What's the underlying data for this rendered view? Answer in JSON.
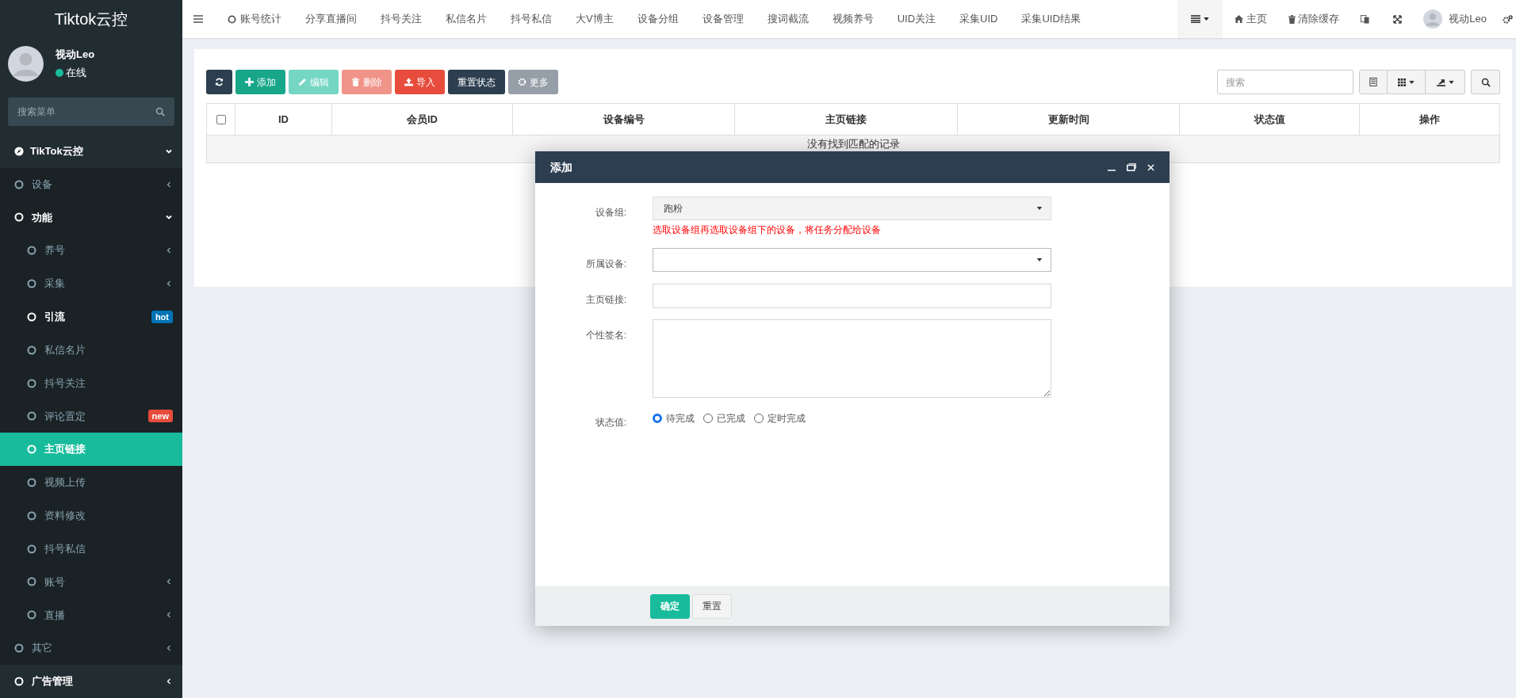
{
  "app_title": "Tiktok云控",
  "user": {
    "name": "视动Leo",
    "status": "在线",
    "online": true
  },
  "sidebar": {
    "search_placeholder": "搜索菜单",
    "items": [
      {
        "label": "TikTok云控",
        "expanded": true,
        "children": [
          {
            "label": "设备",
            "expanded": false,
            "selected": false
          },
          {
            "label": "功能",
            "expanded": true,
            "children": [
              {
                "label": "养号",
                "expanded": false,
                "selected": false
              },
              {
                "label": "采集",
                "expanded": false,
                "selected": false
              },
              {
                "label": "引流",
                "highlighted": true,
                "selected": false,
                "badge": {
                  "text": "hot",
                  "color": "#0073b7"
                }
              },
              {
                "label": "私信名片",
                "selected": false
              },
              {
                "label": "抖号关注",
                "selected": false
              },
              {
                "label": "评论置定",
                "selected": false,
                "badge": {
                  "text": "new",
                  "color": "#e74c3c"
                }
              },
              {
                "label": "主页链接",
                "selected": true
              },
              {
                "label": "视频上传",
                "selected": false
              },
              {
                "label": "资料修改",
                "selected": false
              },
              {
                "label": "抖号私信",
                "selected": false
              },
              {
                "label": "账号",
                "expanded": false,
                "selected": false
              },
              {
                "label": "直播",
                "expanded": false,
                "selected": false
              }
            ]
          },
          {
            "label": "其它",
            "expanded": false,
            "selected": false
          }
        ]
      },
      {
        "label": "广告管理",
        "expanded": false
      }
    ]
  },
  "top_nav": {
    "tabs": [
      {
        "label": "账号统计",
        "selected": false,
        "icon": true
      },
      {
        "label": "分享直播间",
        "selected": false
      },
      {
        "label": "抖号关注",
        "selected": false
      },
      {
        "label": "私信名片",
        "selected": false
      },
      {
        "label": "抖号私信",
        "selected": false
      },
      {
        "label": "大V博主",
        "selected": false
      },
      {
        "label": "设备分组",
        "selected": false
      },
      {
        "label": "设备管理",
        "selected": false
      },
      {
        "label": "搜词截流",
        "selected": false
      },
      {
        "label": "视频养号",
        "selected": false
      },
      {
        "label": "UID关注",
        "selected": false
      },
      {
        "label": "采集UID",
        "selected": false
      },
      {
        "label": "采集UID结果",
        "selected": false
      }
    ],
    "home": "主页",
    "clear_cache": "清除缓存",
    "user_name": "视动Leo"
  },
  "toolbar": {
    "buttons": [
      {
        "kind": "refresh",
        "disabled": false
      },
      {
        "kind": "add",
        "label": "添加",
        "disabled": false
      },
      {
        "kind": "edit",
        "label": "编辑",
        "disabled": true
      },
      {
        "kind": "delete",
        "label": "删除",
        "disabled": true
      },
      {
        "kind": "import",
        "label": "导入",
        "disabled": false
      },
      {
        "kind": "reset",
        "label": "重置状态",
        "disabled": false
      },
      {
        "kind": "more",
        "label": "更多",
        "disabled": true
      }
    ],
    "search_placeholder": "搜索"
  },
  "table": {
    "select_all_checked": false,
    "columns": [
      "ID",
      "会员ID",
      "设备编号",
      "主页链接",
      "更新时间",
      "状态值",
      "操作"
    ],
    "empty_message": "没有找到匹配的记录"
  },
  "dialog": {
    "title": "添加",
    "fields": [
      {
        "kind": "select",
        "label": "设备组:",
        "value": "跑粉",
        "disabled": true,
        "hint": "选取设备组再选取设备组下的设备，将任务分配给设备"
      },
      {
        "kind": "select",
        "label": "所属设备:",
        "disabled": false
      },
      {
        "kind": "text",
        "label": "主页链接:"
      },
      {
        "kind": "textarea",
        "label": "个性签名:"
      },
      {
        "kind": "radio",
        "label": "状态值:",
        "options": [
          {
            "label": "待完成",
            "selected": true
          },
          {
            "label": "已完成",
            "selected": false
          },
          {
            "label": "定时完成",
            "selected": false
          }
        ]
      }
    ],
    "buttons": [
      {
        "label": "确定",
        "kind": "primary"
      },
      {
        "label": "重置",
        "kind": "default"
      }
    ]
  }
}
